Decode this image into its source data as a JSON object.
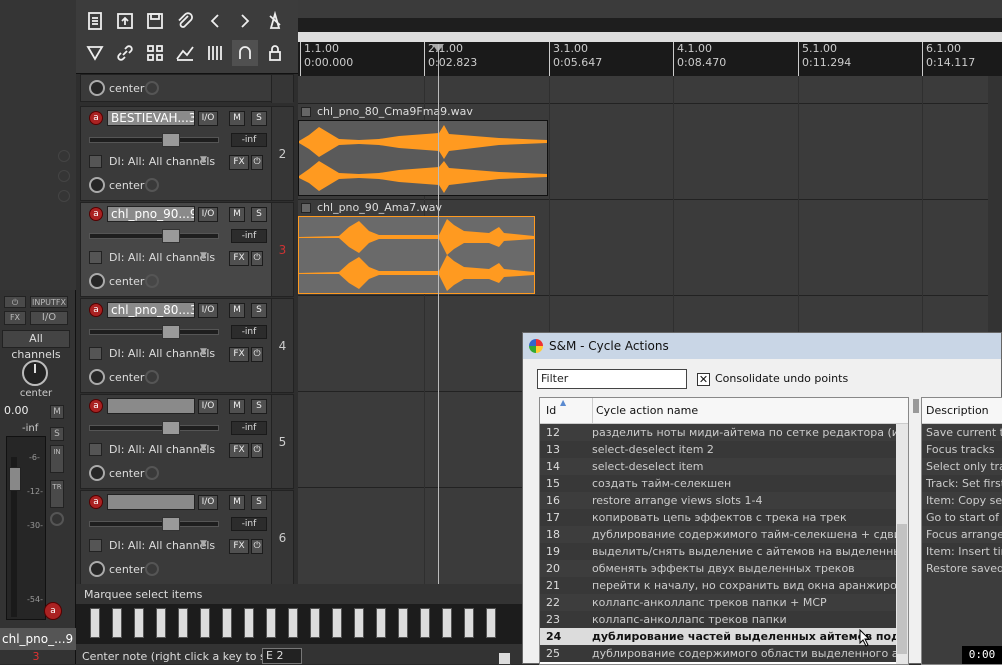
{
  "toolbar": {
    "icons": [
      "new-project-icon",
      "open-project-icon",
      "save-project-icon",
      "attach-icon",
      "undo-icon",
      "redo-icon",
      "metronome-icon",
      "trim-icon",
      "link-icon",
      "grid-icon",
      "envelope-icon",
      "snap-icon",
      "magnet-icon",
      "lock-icon"
    ]
  },
  "ruler": {
    "marks": [
      {
        "bar": "1.1.00",
        "time": "0:00.000"
      },
      {
        "bar": "2.1.00",
        "time": "0:02.823"
      },
      {
        "bar": "3.1.00",
        "time": "0:05.647"
      },
      {
        "bar": "4.1.00",
        "time": "0:08.470"
      },
      {
        "bar": "5.1.00",
        "time": "0:11.294"
      },
      {
        "bar": "6.1.00",
        "time": "0:14.117"
      }
    ]
  },
  "tracks": [
    {
      "num": "2",
      "name": "BESTIEVAH...3",
      "vol": "-inf",
      "input": "DI: All: All channels",
      "pan": "center",
      "selected": false
    },
    {
      "num": "3",
      "name": "chl_pno_90...9",
      "vol": "-inf",
      "input": "DI: All: All channels",
      "pan": "center",
      "selected": true
    },
    {
      "num": "4",
      "name": "chl_pno_80...3",
      "vol": "-inf",
      "input": "DI: All: All channels",
      "pan": "center",
      "selected": false
    },
    {
      "num": "5",
      "name": "",
      "vol": "-inf",
      "input": "DI: All: All channels",
      "pan": "center",
      "selected": false
    },
    {
      "num": "6",
      "name": "",
      "vol": "-inf",
      "input": "DI: All: All channels",
      "pan": "center",
      "selected": false
    }
  ],
  "top_pan": "center",
  "items": [
    {
      "title": "chl_pno_80_Cma9Fma9.wav"
    },
    {
      "title": "chl_pno_90_Ama7.wav"
    }
  ],
  "mixer": {
    "input_fx": "INPUTFX",
    "fx": "FX",
    "io": "I/O",
    "channels": "All channels",
    "pan": "center",
    "vol": "0.00",
    "peak": "-inf",
    "m": "M",
    "s": "S",
    "scale": [
      "-6-",
      "-12-",
      "-30-",
      "-54-"
    ],
    "track_name": "chl_pno_...9",
    "track_num": "3"
  },
  "labels": {
    "io": "I/O",
    "m": "M",
    "s": "S",
    "fx": "FX"
  },
  "bottom": {
    "marquee": "Marquee select items",
    "center_note": "Center note (right click a key to set):",
    "note_value": "E 2"
  },
  "dialog": {
    "title": "S&M - Cycle Actions",
    "filter": "Filter",
    "consolidate": "Consolidate undo points",
    "col_id": "Id",
    "col_name": "Cycle action name",
    "col_desc": "Description",
    "rows": [
      {
        "id": "12",
        "name": "разделить ноты миди-айтема по сетке редактора (из окна"
      },
      {
        "id": "13",
        "name": "select-deselect item 2"
      },
      {
        "id": "14",
        "name": "select-deselect item"
      },
      {
        "id": "15",
        "name": "создать тайм-селекшен"
      },
      {
        "id": "16",
        "name": "restore arrange views slots 1-4"
      },
      {
        "id": "17",
        "name": "копировать цепь эффектов с трека на трек"
      },
      {
        "id": "18",
        "name": "дублирование содержимого тайм-селекшена + сдвиг айте"
      },
      {
        "id": "19",
        "name": "выделить/снять выделение с айтемов на выделенных тре"
      },
      {
        "id": "20",
        "name": "обменять эффекты двух выделенных треков"
      },
      {
        "id": "21",
        "name": "перейти к началу, но сохранить вид окна аранжировки"
      },
      {
        "id": "22",
        "name": "коллапс-анколлапс треков папки + МСР"
      },
      {
        "id": "23",
        "name": "коллапс-анколлапс треков папки"
      },
      {
        "id": "24",
        "name": "дублирование частей выделенных айтемов под тайм-селе"
      },
      {
        "id": "25",
        "name": "дублирование содержимого области выделенного айтема"
      }
    ],
    "desc_rows": [
      "Save current tra",
      "Focus tracks",
      "Select only track",
      "Track: Set first c",
      "Item: Copy sele",
      "Go to start of tin",
      "Focus arrange",
      "Item: Insert tim",
      "Restore saved t"
    ]
  },
  "clock": "0:00"
}
